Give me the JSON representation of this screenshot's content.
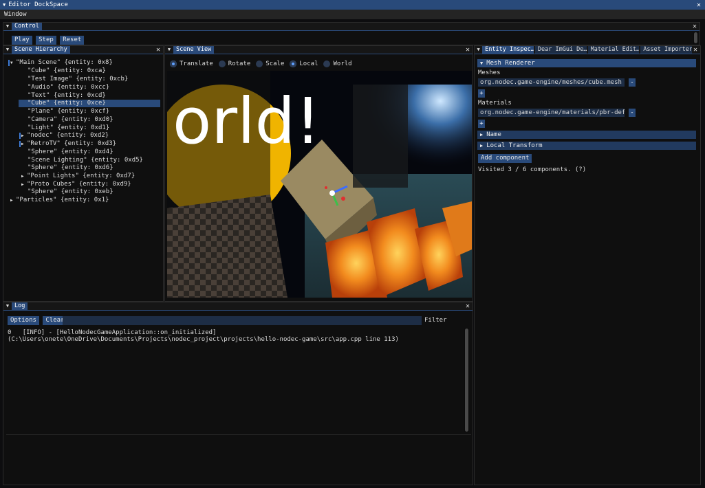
{
  "window": {
    "title": "Editor DockSpace",
    "close": "✕"
  },
  "menu": {
    "items": [
      "Window"
    ]
  },
  "control": {
    "tab": "Control",
    "buttons": [
      "Play",
      "Step",
      "Reset"
    ]
  },
  "hierarchy": {
    "tab": "Scene Hierarchy",
    "rows": [
      "\"Main Scene\" {entity: 0x8}",
      "\"Cube\" {entity: 0xca}",
      "\"Test Image\" {entity: 0xcb}",
      "\"Audio\" {entity: 0xcc}",
      "\"Text\" {entity: 0xcd}",
      "\"Cube\" {entity: 0xce}",
      "\"Plane\" {entity: 0xcf}",
      "\"Camera\" {entity: 0xd0}",
      "\"Light\" {entity: 0xd1}",
      "\"nodec\" {entity: 0xd2}",
      "\"RetroTV\" {entity: 0xd3}",
      "\"Sphere\" {entity: 0xd4}",
      "\"Scene Lighting\" {entity: 0xd5}",
      "\"Sphere\" {entity: 0xd6}",
      "\"Point Lights\" {entity: 0xd7}",
      "\"Proto Cubes\" {entity: 0xd9}",
      "\"Sphere\" {entity: 0xeb}",
      "\"Particles\" {entity: 0x1}"
    ]
  },
  "scene": {
    "tab": "Scene View",
    "modes": [
      "Translate",
      "Rotate",
      "Scale",
      "Local",
      "World"
    ],
    "viewport_text": "orld!"
  },
  "inspector": {
    "tabs": [
      "Entity Inspec…",
      "Dear ImGui De…",
      "Material Edit…",
      "Asset Importer"
    ],
    "mesh_renderer": "Mesh Renderer",
    "meshes_label": "Meshes",
    "mesh_value": "org.nodec.game-engine/meshes/cube.mesh",
    "materials_label": "Materials",
    "material_value": "org.nodec.game-engine/materials/pbr-defer-de",
    "minus": "-",
    "plus": "+",
    "name": "Name",
    "local_transform": "Local Transform",
    "add_component": "Add component",
    "visited": "Visited 3 / 6 components. (?)"
  },
  "log": {
    "tab": "Log",
    "options": "Options",
    "clear": "Clear",
    "filter_label": "Filter",
    "filter_value": "",
    "line1_index": "0",
    "line1": "[INFO] - [HelloNodecGameApplication::on_initialized]",
    "line2": "(C:\\Users\\onete\\OneDrive\\Documents\\Projects\\nodec_project\\projects\\hello-nodec-game\\src\\app.cpp line 113)"
  }
}
